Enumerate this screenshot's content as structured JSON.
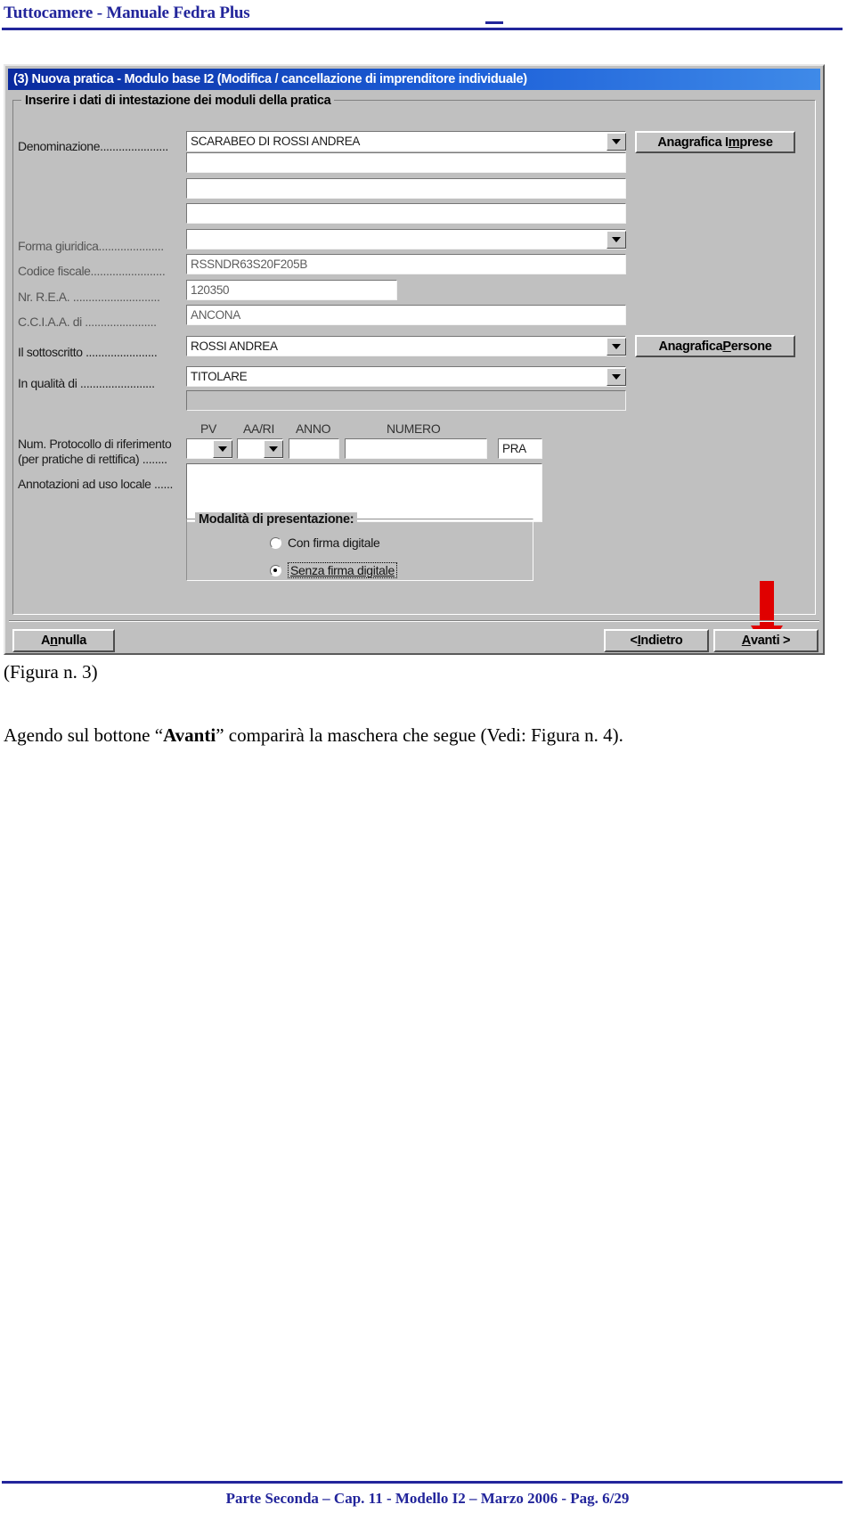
{
  "page": {
    "header_title": "Tuttocamere - Manuale Fedra Plus",
    "header_color": "#22259b",
    "figure_caption": "(Figura n. 3)",
    "footer_text": "Parte Seconda – Cap. 11 - Modello I2 – Marzo 2006 - Pag. 6/29"
  },
  "body": {
    "paragraph_pre": "Agendo sul bottone “",
    "paragraph_bold": "Avanti",
    "paragraph_post": "” comparirà la maschera che segue (Vedi: Figura n. 4)."
  },
  "dialog": {
    "title": "(3) Nuova pratica - Modulo base I2 (Modifica / cancellazione di imprenditore individuale)",
    "title_bar_color": "#1c5fd8",
    "groupbox_label": "Inserire i dati di intestazione dei moduli della pratica",
    "fields": {
      "denominazione": {
        "label": "Denominazione......................",
        "value": "SCARABEO DI ROSSI ANDREA",
        "line2": "",
        "line3": "",
        "line4": ""
      },
      "forma_giuridica": {
        "label": "Forma giuridica.....................",
        "value": ""
      },
      "codice_fiscale": {
        "label": "Codice fiscale........................",
        "value": "RSSNDR63S20F205B"
      },
      "nr_rea": {
        "label": "Nr. R.E.A. ............................",
        "value": "120350"
      },
      "cciaa": {
        "label": "C.C.I.A.A. di .......................",
        "value": "ANCONA"
      },
      "sottoscritto": {
        "label": "Il sottoscritto .......................",
        "value": "ROSSI ANDREA"
      },
      "qualita": {
        "label": "In qualità di ........................",
        "value": "TITOLARE",
        "line2": ""
      },
      "protocollo": {
        "label_line1": "Num. Protocollo di riferimento",
        "label_line2": "(per pratiche di rettifica) ........",
        "col_pv": "PV",
        "col_aari": "AA/RI",
        "col_anno": "ANNO",
        "col_numero": "NUMERO",
        "value_pv": "",
        "value_aari": "",
        "value_anno": "",
        "value_numero": "",
        "value_pra": "PRA"
      },
      "annotazioni": {
        "label": "Annotazioni ad  uso locale ......",
        "value": ""
      }
    },
    "side_buttons": {
      "anagrafica_imprese_pre": "Anagrafica I",
      "anagrafica_imprese_accel": "m",
      "anagrafica_imprese_post": "prese",
      "anagrafica_persone_pre": "Anagrafica ",
      "anagrafica_persone_accel": "P",
      "anagrafica_persone_post": "ersone"
    },
    "presentation_mode": {
      "legend": "Modalità di presentazione:",
      "option_signed": "Con firma digitale",
      "option_unsigned": "Senza firma digitale",
      "selected": "Senza firma digitale"
    },
    "footer_buttons": {
      "annulla_pre": "A",
      "annulla_accel": "n",
      "annulla_post": "nulla",
      "indietro_pre": "< ",
      "indietro_accel": "I",
      "indietro_post": "ndietro",
      "avanti_pre": "",
      "avanti_accel": "A",
      "avanti_post": "vanti >"
    },
    "annotation": {
      "arrow_color": "#e00000",
      "arrow_name": "red-down-arrow"
    }
  }
}
